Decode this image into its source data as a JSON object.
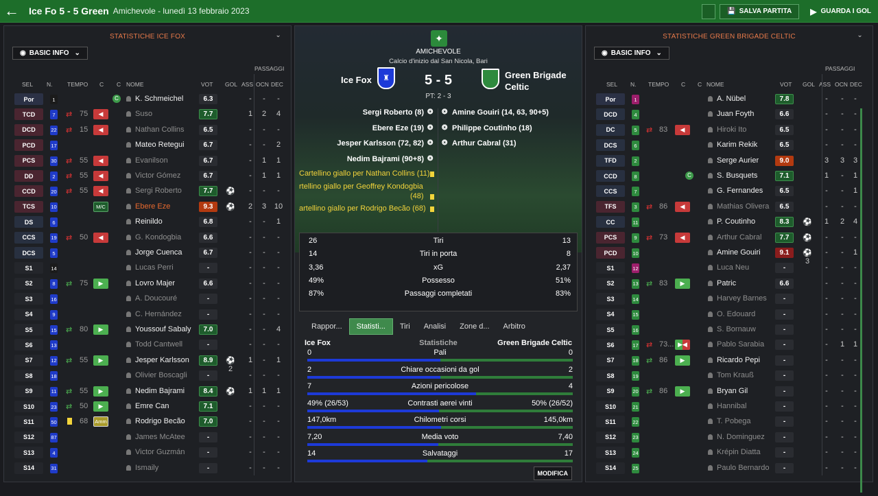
{
  "topbar": {
    "title": "Ice Fo 5 - 5 Green",
    "subtitle": "Amichevole - lunedì 13 febbraio 2023",
    "save": "SALVA PARTITA",
    "watch": "GUARDA I GOL"
  },
  "left": {
    "title": "STATISTICHE ICE FOX",
    "view": "BASIC INFO",
    "passaggi": "PASSAGGI",
    "headers": {
      "sel": "SEL",
      "n": "N.",
      "tempo": "TEMPO",
      "c1": "C",
      "c2": "C",
      "nome": "NOME",
      "vot": "VOT",
      "gol": "GOL",
      "ass": "ASS",
      "ocn": "OCN",
      "dec": "DEC"
    },
    "rows": [
      {
        "pos": "Por",
        "pc": "g",
        "n": "1",
        "nc": "#1b1b1b",
        "name": "K. Schmeichel",
        "vot": "6.3",
        "vc": "dk",
        "gol": "",
        "ass": "-",
        "ocn": "-",
        "dec": "-",
        "green": true
      },
      {
        "pos": "TCD",
        "pc": "d",
        "n": "7",
        "nc": "#1f3bc9",
        "t": "75",
        "arr": "out",
        "name": "Suso",
        "dim": true,
        "vot": "7.7",
        "vc": "gr",
        "gol": "",
        "ass": "1",
        "ocn": "2",
        "dec": "4"
      },
      {
        "pos": "DCD",
        "pc": "d",
        "n": "22",
        "nc": "#1f3bc9",
        "t": "15",
        "arr": "out",
        "name": "Nathan Collins",
        "dim": true,
        "vot": "6.5",
        "vc": "dk",
        "gol": "",
        "ass": "-",
        "ocn": "-",
        "dec": "-"
      },
      {
        "pos": "PCD",
        "pc": "d",
        "n": "17",
        "nc": "#1f3bc9",
        "name": "Mateo Retegui",
        "vot": "6.7",
        "vc": "dk",
        "gol": "",
        "ass": "-",
        "ocn": "-",
        "dec": "2"
      },
      {
        "pos": "PCS",
        "pc": "d",
        "n": "30",
        "nc": "#1f3bc9",
        "t": "55",
        "arr": "out",
        "name": "Evanilson",
        "dim": true,
        "vot": "6.7",
        "vc": "dk",
        "gol": "",
        "ass": "-",
        "ocn": "1",
        "dec": "1"
      },
      {
        "pos": "DD",
        "pc": "d",
        "n": "2",
        "nc": "#1f3bc9",
        "t": "55",
        "arr": "out",
        "name": "Victor Gómez",
        "dim": true,
        "vot": "6.7",
        "vc": "dk",
        "gol": "",
        "ass": "-",
        "ocn": "1",
        "dec": "1"
      },
      {
        "pos": "CCD",
        "pc": "d",
        "n": "20",
        "nc": "#1f3bc9",
        "t": "55",
        "arr": "out",
        "name": "Sergi Roberto",
        "dim": true,
        "vot": "7.7",
        "vc": "gr",
        "gol": "⚽",
        "ass": "-",
        "ocn": "-",
        "dec": "-"
      },
      {
        "pos": "TCS",
        "pc": "d",
        "n": "10",
        "nc": "#1f3bc9",
        "badge": "M/C",
        "name": "Ebere Eze",
        "orange": true,
        "vot": "9.3",
        "vc": "or",
        "gol": "⚽",
        "ass": "2",
        "ocn": "3",
        "dec": "10"
      },
      {
        "pos": "DS",
        "pc": "a",
        "n": "6",
        "nc": "#1f3bc9",
        "name": "Reinildo",
        "vot": "6.8",
        "vc": "dk",
        "gol": "",
        "ass": "-",
        "ocn": "-",
        "dec": "1"
      },
      {
        "pos": "CCS",
        "pc": "a",
        "n": "19",
        "nc": "#1f3bc9",
        "t": "50",
        "arr": "out",
        "name": "G. Kondogbia",
        "dim": true,
        "vot": "6.6",
        "vc": "dk",
        "gol": "",
        "ass": "-",
        "ocn": "-",
        "dec": "-"
      },
      {
        "pos": "DCS",
        "pc": "a",
        "n": "5",
        "nc": "#1f3bc9",
        "name": "Jorge Cuenca",
        "vot": "6.7",
        "vc": "dk",
        "gol": "",
        "ass": "-",
        "ocn": "-",
        "dec": "-"
      },
      {
        "pos": "S1",
        "pc": "s",
        "n": "14",
        "nc": "#1b1b1b",
        "name": "Lucas Perri",
        "dim": true,
        "vot": "-",
        "vc": "dk",
        "gol": "",
        "ass": "-",
        "ocn": "-",
        "dec": "-"
      },
      {
        "pos": "S2",
        "pc": "s",
        "n": "8",
        "nc": "#1f3bc9",
        "t": "75",
        "arr": "in",
        "name": "Lovro Majer",
        "vot": "6.6",
        "vc": "dk",
        "gol": "",
        "ass": "-",
        "ocn": "-",
        "dec": "-"
      },
      {
        "pos": "S3",
        "pc": "s",
        "n": "16",
        "nc": "#1f3bc9",
        "name": "A. Doucouré",
        "dim": true,
        "vot": "-",
        "vc": "dk",
        "gol": "",
        "ass": "-",
        "ocn": "-",
        "dec": "-"
      },
      {
        "pos": "S4",
        "pc": "s",
        "n": "9",
        "nc": "#1f3bc9",
        "name": "C. Hernández",
        "dim": true,
        "vot": "-",
        "vc": "dk",
        "gol": "",
        "ass": "-",
        "ocn": "-",
        "dec": "-"
      },
      {
        "pos": "S5",
        "pc": "s",
        "n": "15",
        "nc": "#1f3bc9",
        "t": "80",
        "arr": "in",
        "name": "Youssouf Sabaly",
        "vot": "7.0",
        "vc": "gr",
        "gol": "",
        "ass": "-",
        "ocn": "-",
        "dec": "4"
      },
      {
        "pos": "S6",
        "pc": "s",
        "n": "13",
        "nc": "#1f3bc9",
        "name": "Todd Cantwell",
        "dim": true,
        "vot": "-",
        "vc": "dk",
        "gol": "",
        "ass": "-",
        "ocn": "-",
        "dec": "-"
      },
      {
        "pos": "S7",
        "pc": "s",
        "n": "12",
        "nc": "#1f3bc9",
        "t": "55",
        "arr": "in",
        "name": "Jesper Karlsson",
        "vot": "8.9",
        "vc": "gr",
        "gol": "⚽2",
        "ass": "1",
        "ocn": "-",
        "dec": "1"
      },
      {
        "pos": "S8",
        "pc": "s",
        "n": "18",
        "nc": "#1f3bc9",
        "name": "Olivier Boscagli",
        "dim": true,
        "vot": "-",
        "vc": "dk",
        "gol": "",
        "ass": "-",
        "ocn": "-",
        "dec": "-"
      },
      {
        "pos": "S9",
        "pc": "s",
        "n": "11",
        "nc": "#1f3bc9",
        "t": "55",
        "arr": "in",
        "name": "Nedim Bajrami",
        "vot": "8.4",
        "vc": "gr",
        "gol": "⚽",
        "ass": "1",
        "ocn": "1",
        "dec": "1"
      },
      {
        "pos": "S10",
        "pc": "s",
        "n": "23",
        "nc": "#1f3bc9",
        "t": "50",
        "arr": "in",
        "name": "Emre Can",
        "vot": "7.1",
        "vc": "gr",
        "gol": "",
        "ass": "-",
        "ocn": "-",
        "dec": "-"
      },
      {
        "pos": "S11",
        "pc": "s",
        "n": "50",
        "nc": "#1f3bc9",
        "t": "68",
        "arr": "amm",
        "yc": true,
        "name": "Rodrigo Becão",
        "vot": "7.0",
        "vc": "gr",
        "gol": "",
        "ass": "-",
        "ocn": "-",
        "dec": "-"
      },
      {
        "pos": "S12",
        "pc": "s",
        "n": "87",
        "nc": "#1f3bc9",
        "name": "James McAtee",
        "dim": true,
        "vot": "-",
        "vc": "dk",
        "gol": "",
        "ass": "-",
        "ocn": "-",
        "dec": "-"
      },
      {
        "pos": "S13",
        "pc": "s",
        "n": "4",
        "nc": "#1f3bc9",
        "name": "Victor Guzmán",
        "dim": true,
        "vot": "-",
        "vc": "dk",
        "gol": "",
        "ass": "-",
        "ocn": "-",
        "dec": "-"
      },
      {
        "pos": "S14",
        "pc": "s",
        "n": "31",
        "nc": "#1f3bc9",
        "name": "Ismaily",
        "dim": true,
        "vot": "-",
        "vc": "dk",
        "gol": "",
        "ass": "-",
        "ocn": "-",
        "dec": "-"
      }
    ]
  },
  "right": {
    "title": "STATISTICHE GREEN BRIGADE CELTIC",
    "view": "BASIC INFO",
    "passaggi": "PASSAGGI",
    "headers": {
      "sel": "SEL",
      "n": "N.",
      "tempo": "TEMPO",
      "c1": "C",
      "c2": "C",
      "nome": "NOME",
      "vot": "VOT",
      "gol": "GOL",
      "ass": "ASS",
      "ocn": "OCN",
      "dec": "DEC"
    },
    "rows": [
      {
        "pos": "Por",
        "pc": "g",
        "n": "1",
        "nc": "#9c1e6b",
        "name": "A. Nübel",
        "vot": "7.8",
        "vc": "gr",
        "gol": "",
        "ass": "-",
        "ocn": "-",
        "dec": "-"
      },
      {
        "pos": "DCD",
        "pc": "a",
        "n": "4",
        "nc": "#2e8a3e",
        "name": "Juan Foyth",
        "vot": "6.6",
        "vc": "dk",
        "gol": "",
        "ass": "-",
        "ocn": "-",
        "dec": "-"
      },
      {
        "pos": "DC",
        "pc": "a",
        "n": "5",
        "nc": "#2e8a3e",
        "t": "83",
        "arr": "out",
        "name": "Hiroki Ito",
        "dim": true,
        "vot": "6.5",
        "vc": "dk",
        "gol": "",
        "ass": "-",
        "ocn": "-",
        "dec": "-"
      },
      {
        "pos": "DCS",
        "pc": "a",
        "n": "6",
        "nc": "#2e8a3e",
        "name": "Karim Rekik",
        "vot": "6.5",
        "vc": "dk",
        "gol": "",
        "ass": "-",
        "ocn": "-",
        "dec": "-"
      },
      {
        "pos": "TFD",
        "pc": "a",
        "n": "2",
        "nc": "#2e8a3e",
        "name": "Serge Aurier",
        "vot": "9.0",
        "vc": "or",
        "gol": "",
        "ass": "3",
        "ocn": "3",
        "dec": "3"
      },
      {
        "pos": "CCD",
        "pc": "a",
        "n": "8",
        "nc": "#2e8a3e",
        "name": "S. Busquets",
        "green": true,
        "vot": "7.1",
        "vc": "gr",
        "gol": "",
        "ass": "1",
        "ocn": "-",
        "dec": "1"
      },
      {
        "pos": "CCS",
        "pc": "a",
        "n": "7",
        "nc": "#2e8a3e",
        "name": "G. Fernandes",
        "vot": "6.5",
        "vc": "dk",
        "gol": "",
        "ass": "-",
        "ocn": "-",
        "dec": "1"
      },
      {
        "pos": "TFS",
        "pc": "d",
        "n": "3",
        "nc": "#2e8a3e",
        "t": "86",
        "arr": "out",
        "name": "Mathias Olivera",
        "dim": true,
        "vot": "6.5",
        "vc": "dk",
        "gol": "",
        "ass": "-",
        "ocn": "-",
        "dec": "-"
      },
      {
        "pos": "CC",
        "pc": "a",
        "n": "11",
        "nc": "#2e8a3e",
        "name": "P. Coutinho",
        "vot": "8.3",
        "vc": "gr",
        "gol": "⚽",
        "ass": "1",
        "ocn": "2",
        "dec": "4"
      },
      {
        "pos": "PCS",
        "pc": "d",
        "n": "9",
        "nc": "#2e8a3e",
        "t": "73",
        "arr": "out",
        "name": "Arthur Cabral",
        "dim": true,
        "vot": "7.7",
        "vc": "gr",
        "gol": "⚽",
        "ass": "-",
        "ocn": "-",
        "dec": "-"
      },
      {
        "pos": "PCD",
        "pc": "d",
        "n": "10",
        "nc": "#2e8a3e",
        "name": "Amine Gouiri",
        "vot": "9.1",
        "vc": "rd",
        "gol": "⚽3",
        "ass": "-",
        "ocn": "-",
        "dec": "1"
      },
      {
        "pos": "S1",
        "pc": "s",
        "n": "12",
        "nc": "#9c1e6b",
        "name": "Luca Neu",
        "dim": true,
        "vot": "-",
        "vc": "dk",
        "gol": "",
        "ass": "-",
        "ocn": "-",
        "dec": "-"
      },
      {
        "pos": "S2",
        "pc": "s",
        "n": "13",
        "nc": "#2e8a3e",
        "t": "83",
        "arr": "in",
        "name": "Patric",
        "vot": "6.6",
        "vc": "dk",
        "gol": "",
        "ass": "-",
        "ocn": "-",
        "dec": "-"
      },
      {
        "pos": "S3",
        "pc": "s",
        "n": "14",
        "nc": "#2e8a3e",
        "name": "Harvey Barnes",
        "dim": true,
        "vot": "-",
        "vc": "dk",
        "gol": "",
        "ass": "-",
        "ocn": "-",
        "dec": "-"
      },
      {
        "pos": "S4",
        "pc": "s",
        "n": "15",
        "nc": "#2e8a3e",
        "name": "O. Edouard",
        "dim": true,
        "vot": "-",
        "vc": "dk",
        "gol": "",
        "ass": "-",
        "ocn": "-",
        "dec": "-"
      },
      {
        "pos": "S5",
        "pc": "s",
        "n": "16",
        "nc": "#2e8a3e",
        "name": "S. Bornauw",
        "dim": true,
        "vot": "-",
        "vc": "dk",
        "gol": "",
        "ass": "-",
        "ocn": "-",
        "dec": "-"
      },
      {
        "pos": "S6",
        "pc": "s",
        "n": "17",
        "nc": "#2e8a3e",
        "t": "73...",
        "arr": "both",
        "name": "Pablo Sarabia",
        "dim": true,
        "vot": "-",
        "vc": "dk",
        "gol": "",
        "ass": "-",
        "ocn": "1",
        "dec": "1"
      },
      {
        "pos": "S7",
        "pc": "s",
        "n": "18",
        "nc": "#2e8a3e",
        "t": "86",
        "arr": "in",
        "name": "Ricardo Pepi",
        "vot": "-",
        "vc": "dk",
        "gol": "",
        "ass": "-",
        "ocn": "-",
        "dec": "-"
      },
      {
        "pos": "S8",
        "pc": "s",
        "n": "19",
        "nc": "#2e8a3e",
        "name": "Tom Krauß",
        "dim": true,
        "vot": "-",
        "vc": "dk",
        "gol": "",
        "ass": "-",
        "ocn": "-",
        "dec": "-"
      },
      {
        "pos": "S9",
        "pc": "s",
        "n": "20",
        "nc": "#2e8a3e",
        "t": "86",
        "arr": "in",
        "name": "Bryan Gil",
        "vot": "-",
        "vc": "dk",
        "gol": "",
        "ass": "-",
        "ocn": "-",
        "dec": "-"
      },
      {
        "pos": "S10",
        "pc": "s",
        "n": "21",
        "nc": "#2e8a3e",
        "name": "Hannibal",
        "dim": true,
        "vot": "-",
        "vc": "dk",
        "gol": "",
        "ass": "-",
        "ocn": "-",
        "dec": "-"
      },
      {
        "pos": "S11",
        "pc": "s",
        "n": "22",
        "nc": "#2e8a3e",
        "name": "T. Pobega",
        "dim": true,
        "vot": "-",
        "vc": "dk",
        "gol": "",
        "ass": "-",
        "ocn": "-",
        "dec": "-"
      },
      {
        "pos": "S12",
        "pc": "s",
        "n": "23",
        "nc": "#2e8a3e",
        "name": "N. Dominguez",
        "dim": true,
        "vot": "-",
        "vc": "dk",
        "gol": "",
        "ass": "-",
        "ocn": "-",
        "dec": "-"
      },
      {
        "pos": "S13",
        "pc": "s",
        "n": "24",
        "nc": "#2e8a3e",
        "name": "Krépin Diatta",
        "dim": true,
        "vot": "-",
        "vc": "dk",
        "gol": "",
        "ass": "-",
        "ocn": "-",
        "dec": "-"
      },
      {
        "pos": "S14",
        "pc": "s",
        "n": "25",
        "nc": "#2e8a3e",
        "name": "Paulo Bernardo",
        "dim": true,
        "vot": "-",
        "vc": "dk",
        "gol": "",
        "ass": "-",
        "ocn": "-",
        "dec": "-"
      }
    ]
  },
  "match": {
    "competition": "AMICHEVOLE",
    "stadium": "Calcio d'inizio dal San Nicola, Bari",
    "home": "Ice Fox",
    "away_l1": "Green Brigade",
    "away_l2": "Celtic",
    "score": "5 - 5",
    "pt": "PT: 2 - 3",
    "home_scorers": [
      "Sergi Roberto (8)",
      "Ebere Eze (19)",
      "Jesper Karlsson (72, 82)",
      "Nedim Bajrami (90+8)"
    ],
    "away_scorers": [
      "Amine Gouiri (14, 63, 90+5)",
      "Philippe Coutinho (18)",
      "Arthur Cabral (31)"
    ],
    "events": [
      "Cartellino giallo per Nathan Collins (11)",
      "rtellino giallo per Geoffrey Kondogbia",
      "(48)",
      "artellino giallo per Rodrigo Becão (68)"
    ],
    "summary": [
      {
        "h": "26",
        "l": "Tiri",
        "a": "13"
      },
      {
        "h": "14",
        "l": "Tiri in porta",
        "a": "8"
      },
      {
        "h": "3,36",
        "l": "xG",
        "a": "2,37"
      },
      {
        "h": "49%",
        "l": "Possesso",
        "a": "51%"
      },
      {
        "h": "87%",
        "l": "Passaggi completati",
        "a": "83%"
      }
    ],
    "tabs": [
      "Rappor...",
      "Statisti...",
      "Tiri",
      "Analisi",
      "Zone d...",
      "Arbitro"
    ],
    "stats_header": {
      "home": "Ice Fox",
      "mid": "Statistiche",
      "away": "Green Brigade Celtic"
    },
    "stats": [
      {
        "h": "0",
        "l": "Pali",
        "a": "0",
        "hv": 0,
        "av": 0
      },
      {
        "h": "2",
        "l": "Chiare occasioni da gol",
        "a": "2",
        "hv": 2,
        "av": 2
      },
      {
        "h": "7",
        "l": "Azioni pericolose",
        "a": "4",
        "hv": 7,
        "av": 4
      },
      {
        "h": "49% (26/53)",
        "l": "Contrasti aerei vinti",
        "a": "50% (26/52)",
        "hv": 49,
        "av": 50
      },
      {
        "h": "147,0km",
        "l": "Chilometri corsi",
        "a": "145,0km",
        "hv": 147,
        "av": 145
      },
      {
        "h": "7,20",
        "l": "Media voto",
        "a": "7,40",
        "hv": 7.2,
        "av": 7.4
      },
      {
        "h": "14",
        "l": "Salvataggi",
        "a": "17",
        "hv": 14,
        "av": 17
      }
    ],
    "modifica": "MODIFICA"
  },
  "colors": {
    "accent": "#2e8a3e",
    "home_blue": "#1d3ad8",
    "topbar": "#1d6e2a"
  }
}
